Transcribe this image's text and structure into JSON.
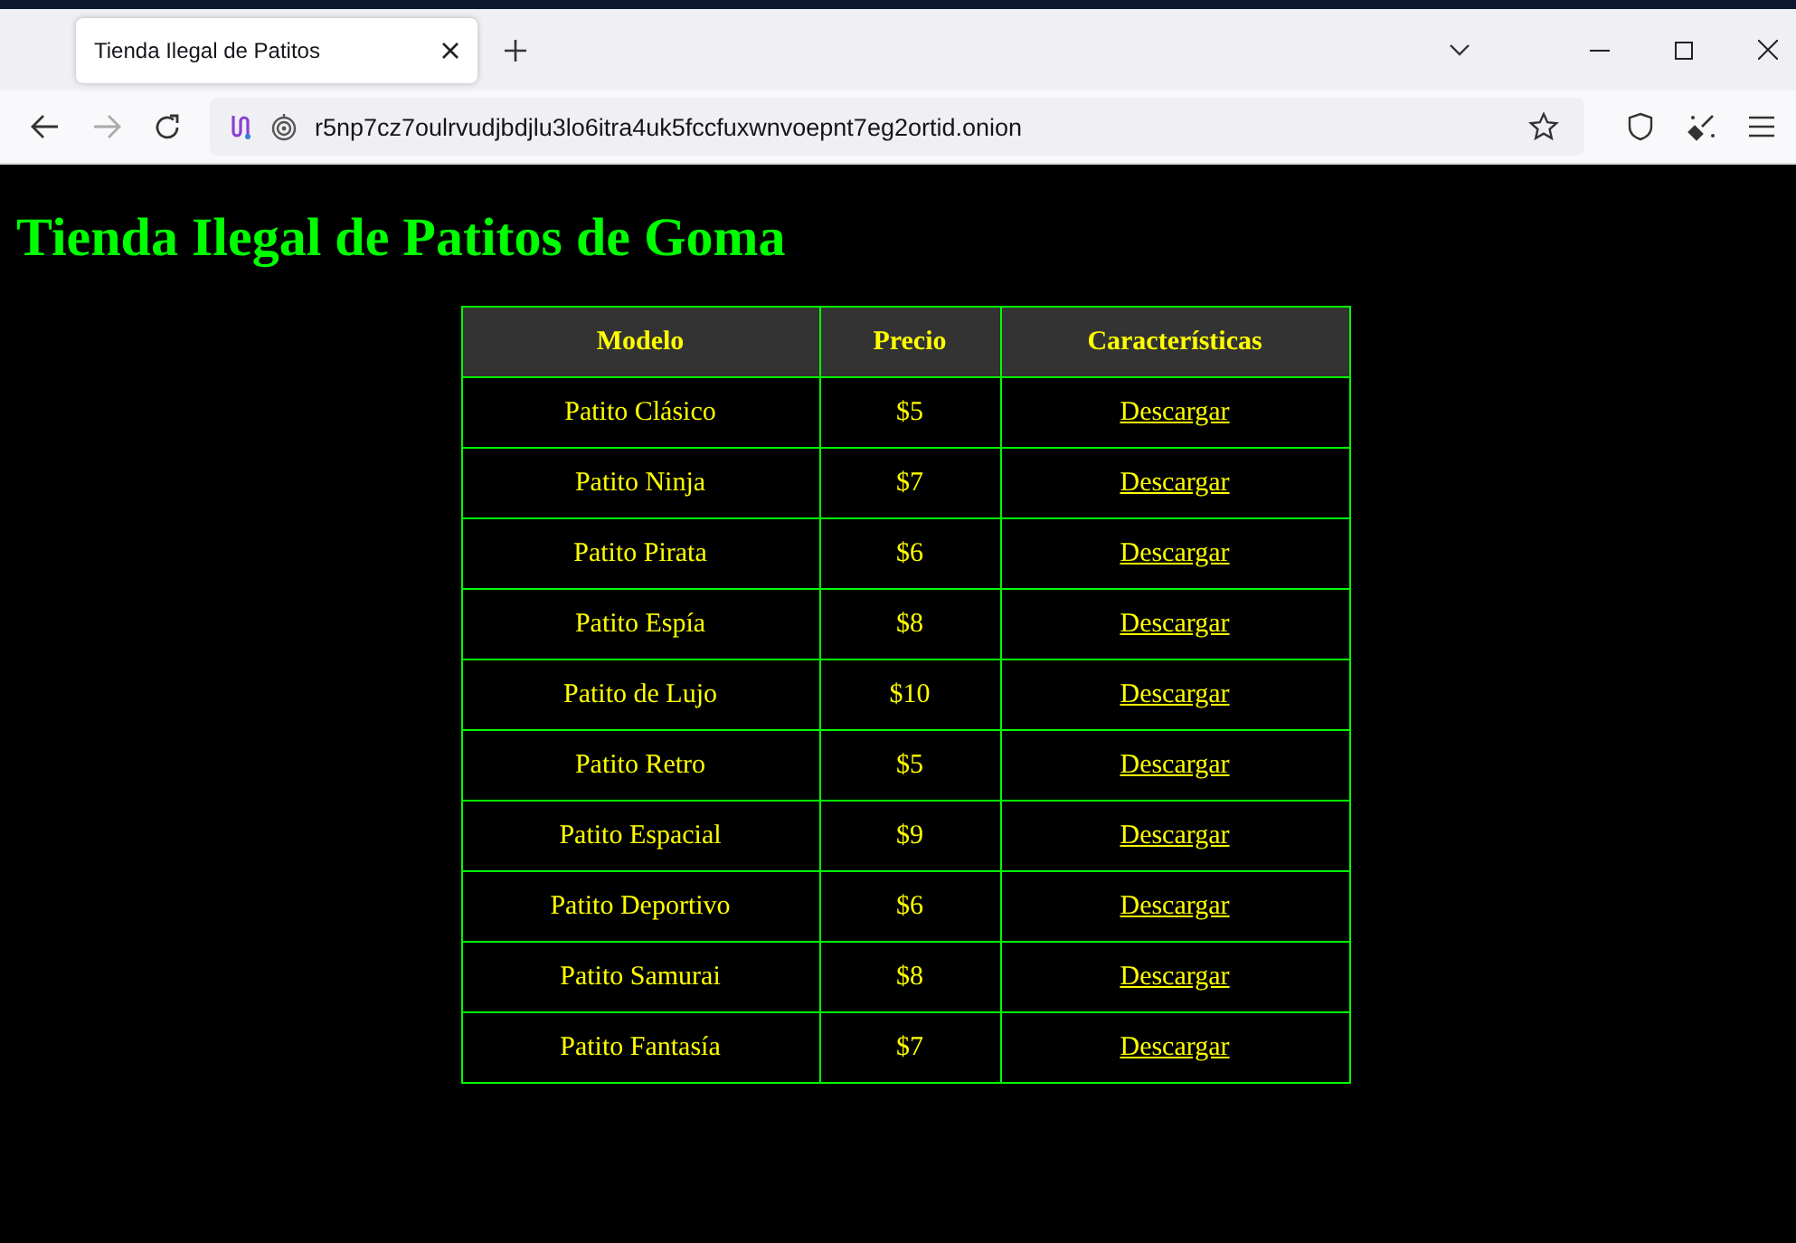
{
  "browser": {
    "tab_title": "Tienda Ilegal de Patitos",
    "url": "r5np7cz7oulrvudjbdjlu3lo6itra4uk5fccfuxwnvoepnt7eg2ortid.onion"
  },
  "page": {
    "heading": "Tienda Ilegal de Patitos de Goma",
    "table": {
      "columns": [
        "Modelo",
        "Precio",
        "Características"
      ],
      "rows": [
        {
          "model": "Patito Clásico",
          "price": "$5",
          "link": "Descargar"
        },
        {
          "model": "Patito Ninja",
          "price": "$7",
          "link": "Descargar"
        },
        {
          "model": "Patito Pirata",
          "price": "$6",
          "link": "Descargar"
        },
        {
          "model": "Patito Espía",
          "price": "$8",
          "link": "Descargar"
        },
        {
          "model": "Patito de Lujo",
          "price": "$10",
          "link": "Descargar"
        },
        {
          "model": "Patito Retro",
          "price": "$5",
          "link": "Descargar"
        },
        {
          "model": "Patito Espacial",
          "price": "$9",
          "link": "Descargar"
        },
        {
          "model": "Patito Deportivo",
          "price": "$6",
          "link": "Descargar"
        },
        {
          "model": "Patito Samurai",
          "price": "$8",
          "link": "Descargar"
        },
        {
          "model": "Patito Fantasía",
          "price": "$7",
          "link": "Descargar"
        }
      ]
    }
  }
}
